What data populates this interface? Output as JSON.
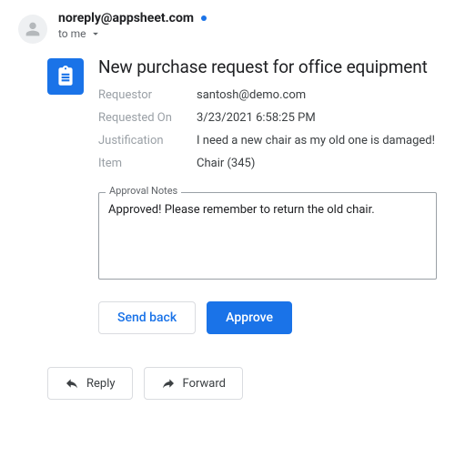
{
  "sender": "noreply@appsheet.com",
  "recipient_line": "to me",
  "card": {
    "title": "New purchase request for office equipment",
    "fields": [
      {
        "label": "Requestor",
        "value": "santosh@demo.com"
      },
      {
        "label": "Requested On",
        "value": "3/23/2021 6:58:25 PM"
      },
      {
        "label": "Justification",
        "value": "I need a new chair as my old one is damaged!"
      },
      {
        "label": "Item",
        "value": "Chair (345)"
      }
    ],
    "notes_legend": "Approval Notes",
    "notes_value": "Approved! Please remember to return the old chair.",
    "actions": {
      "send_back": "Send back",
      "approve": "Approve"
    }
  },
  "footer": {
    "reply": "Reply",
    "forward": "Forward"
  }
}
